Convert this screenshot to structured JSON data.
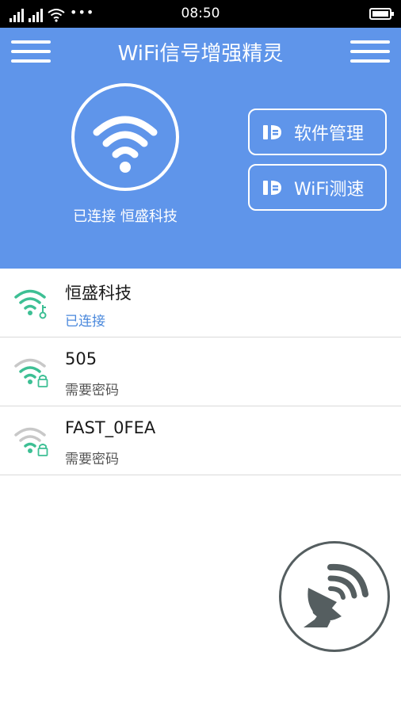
{
  "status_bar": {
    "time": "08:50",
    "more_dots": "•••"
  },
  "header": {
    "title": "WiFi信号增强精灵",
    "connected_label": "已连接 恒盛科技",
    "buttons": {
      "software_manage": "软件管理",
      "wifi_speed": "WiFi测速"
    }
  },
  "networks": [
    {
      "name": "恒盛科技",
      "status": "已连接",
      "icon": "wifi-key-icon"
    },
    {
      "name": "505",
      "status": "需要密码",
      "icon": "wifi-lock-icon"
    },
    {
      "name": "FAST_0FEA",
      "status": "需要密码",
      "icon": "wifi-lock-icon"
    }
  ],
  "colors": {
    "header_bg": "#5f95ea",
    "connected_text": "#4a88dc",
    "wifi_green": "#3dbf94",
    "wifi_gray": "#c8c8c8",
    "radar_gray": "#555e60"
  }
}
